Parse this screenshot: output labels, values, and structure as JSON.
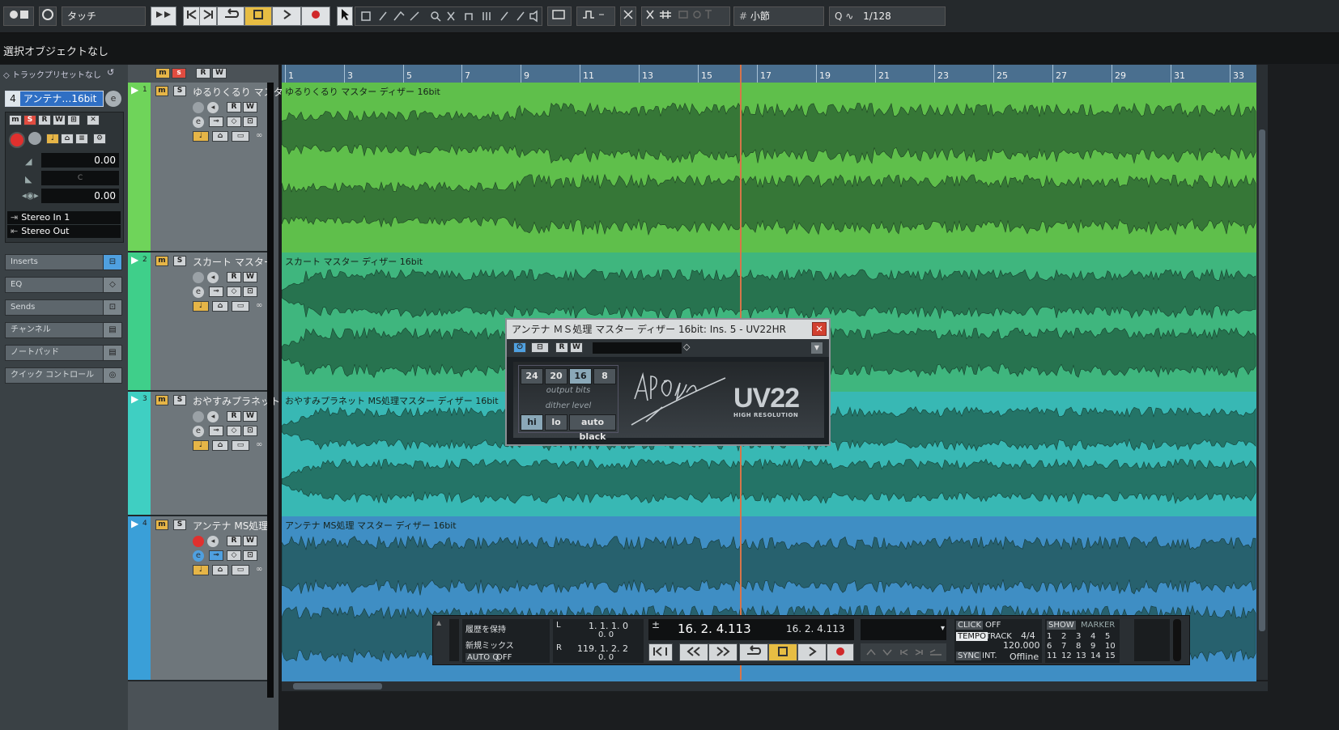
{
  "toolbar": {
    "automation_mode": "タッチ",
    "grid_type": "小節",
    "quantize_label": "Q",
    "quantize_value": "1/128"
  },
  "info_line": {
    "text": "選択オブジェクトなし"
  },
  "inspector": {
    "preset": "トラックプリセットなし",
    "track_number": "4",
    "track_name": "アンテナ…16bit",
    "volume": "0.00",
    "pan": "C",
    "delay": "0.00",
    "input": "Stereo In 1",
    "output": "Stereo Out",
    "sections": [
      "Inserts",
      "EQ",
      "Sends",
      "チャンネル",
      "ノートパッド",
      "クイック コントロール"
    ]
  },
  "ruler": {
    "bars": [
      "1",
      "3",
      "5",
      "7",
      "9",
      "11",
      "13",
      "15",
      "17",
      "19",
      "21",
      "23",
      "25",
      "27",
      "29",
      "31",
      "33"
    ]
  },
  "tracks": [
    {
      "number": "1",
      "name": "ゆるりくるり  マスタ",
      "event": "ゆるりくるり  マスター  ディザー  16bit",
      "color": "#6fd45a",
      "lane": "#5fbf4b"
    },
    {
      "number": "2",
      "name": "スカート  マスター",
      "event": "スカート  マスター  ディザー  16bit",
      "color": "#3fcf8a",
      "lane": "#3fb67e"
    },
    {
      "number": "3",
      "name": "おやすみプラネット",
      "event": "おやすみプラネット  MS処理マスター  ディザー  16bit",
      "color": "#3fcfc2",
      "lane": "#38b8b4"
    },
    {
      "number": "4",
      "name": "アンテナ  MS処理",
      "event": "アンテナ  MS処理  マスター  ディザー  16bit",
      "color": "#3a9fd8",
      "lane": "#3f8ec4"
    }
  ],
  "plugin": {
    "title": "アンテナ  ＭＳ処理  マスター  ディザー  16bit: Ins. 5 - UV22HR",
    "bits": [
      "24",
      "20",
      "16",
      "8"
    ],
    "selected_bits": "16",
    "output_bits_label": "output bits",
    "dither_level_label": "dither level",
    "levels": [
      "hi",
      "lo",
      "auto black"
    ],
    "selected_level": "hi",
    "brand_signature": "APOGEE",
    "brand": "UV22",
    "brand_sub": "HIGH RESOLUTION"
  },
  "transport": {
    "history_label": "履歴を保持",
    "new_mix_label": "新規ミックス",
    "auto_q_label": "AUTO Q",
    "auto_q_value": "OFF",
    "left_locator": "1. 1. 1.  0",
    "left_locator_sub": "0.   0",
    "right_locator": "119. 1. 2.  2",
    "right_locator_sub": "0.   0",
    "primary_position": "16.  2.  4.113",
    "secondary_position": "16.  2.  4.113",
    "click_label": "CLICK",
    "click_value": "OFF",
    "tempo_label": "TEMPO",
    "tempo_mode": "TRACK",
    "signature": "4/4",
    "tempo_value": "120.000",
    "sync_label": "SYNC",
    "sync_mode": "INT.",
    "sync_status": "Offline",
    "show_label": "SHOW",
    "marker_label": "MARKER",
    "markers": [
      "1",
      "2",
      "3",
      "4",
      "5",
      "6",
      "7",
      "8",
      "9",
      "10",
      "11",
      "12",
      "13",
      "14",
      "15"
    ]
  }
}
